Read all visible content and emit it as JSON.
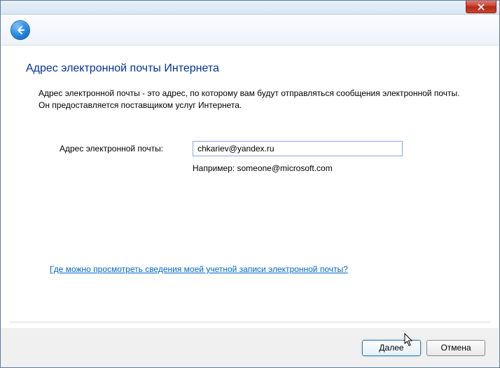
{
  "page_title": "Адрес электронной почты Интернета",
  "description": "Адрес электронной почты - это адрес, по которому вам будут отправляться сообщения электронной почты. Он предоставляется поставщиком услуг Интернета.",
  "form": {
    "email_label": "Адрес электронной почты:",
    "email_value": "chkariev@yandex.ru",
    "email_hint": "Например: someone@microsoft.com"
  },
  "help_link": "Где можно просмотреть сведения моей учетной записи электронной почты?",
  "buttons": {
    "next": "Далее",
    "cancel": "Отмена"
  }
}
